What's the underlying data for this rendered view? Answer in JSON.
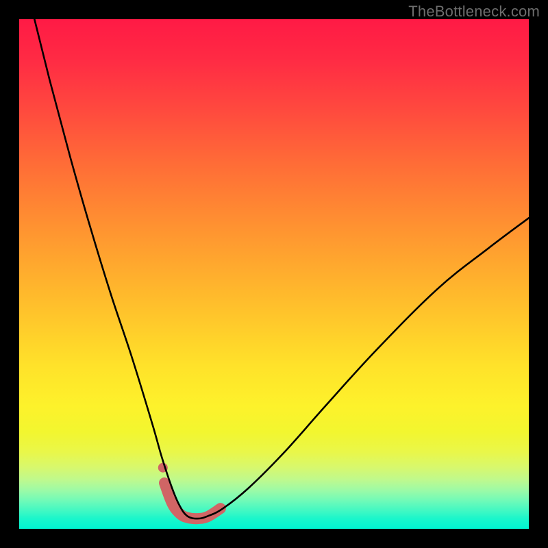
{
  "watermark": "TheBottleneck.com",
  "chart_data": {
    "type": "line",
    "title": "",
    "xlabel": "",
    "ylabel": "",
    "xlim": [
      0,
      100
    ],
    "ylim": [
      0,
      100
    ],
    "grid": false,
    "series": [
      {
        "name": "bottleneck-curve",
        "x": [
          3,
          6,
          10,
          14,
          18,
          22,
          26,
          28,
          30,
          31.5,
          33,
          35,
          37,
          40,
          45,
          52,
          60,
          70,
          82,
          92,
          100
        ],
        "y": [
          100,
          88,
          73,
          59,
          46,
          34,
          21,
          14,
          8,
          4.5,
          2.5,
          2,
          2.5,
          4,
          8,
          15,
          24,
          35,
          47,
          55,
          61
        ]
      }
    ],
    "highlight": {
      "x": [
        28.5,
        30,
        31.5,
        33,
        35,
        37,
        39.5
      ],
      "y": [
        9,
        5,
        3,
        2.2,
        2,
        2.4,
        4
      ]
    },
    "marker": {
      "x": 28.2,
      "y": 12
    },
    "background_gradient": {
      "top": "#ff1a45",
      "mid": "#ffe22a",
      "bottom": "#00f4d1"
    }
  }
}
